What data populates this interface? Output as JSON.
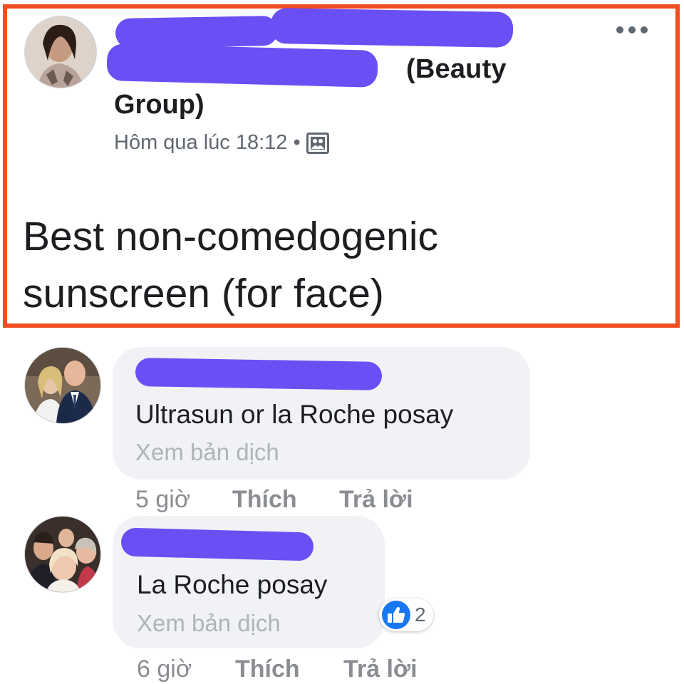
{
  "post": {
    "group_name_suffix": "(Beauty",
    "group_name_line2": "Group)",
    "timestamp": "Hôm qua lúc 18:12",
    "separator": "•",
    "audience_icon": "group-photo-icon",
    "more_icon": "ellipsis-icon",
    "body_line1": "Best non-comedogenic",
    "body_line2": "sunscreen (for face)"
  },
  "comments": [
    {
      "text": "Ultrasun or la Roche posay",
      "translate": "Xem bản dịch",
      "time": "5 giờ",
      "like": "Thích",
      "reply": "Trả lời"
    },
    {
      "text": "La Roche posay",
      "translate": "Xem bản dịch",
      "time": "6 giờ",
      "like": "Thích",
      "reply": "Trả lời",
      "reaction": {
        "icon": "like-icon",
        "count": "2"
      }
    }
  ],
  "colors": {
    "highlight_border": "#f04e23",
    "redaction": "#6b4ff5",
    "like_blue": "#1877f2"
  }
}
